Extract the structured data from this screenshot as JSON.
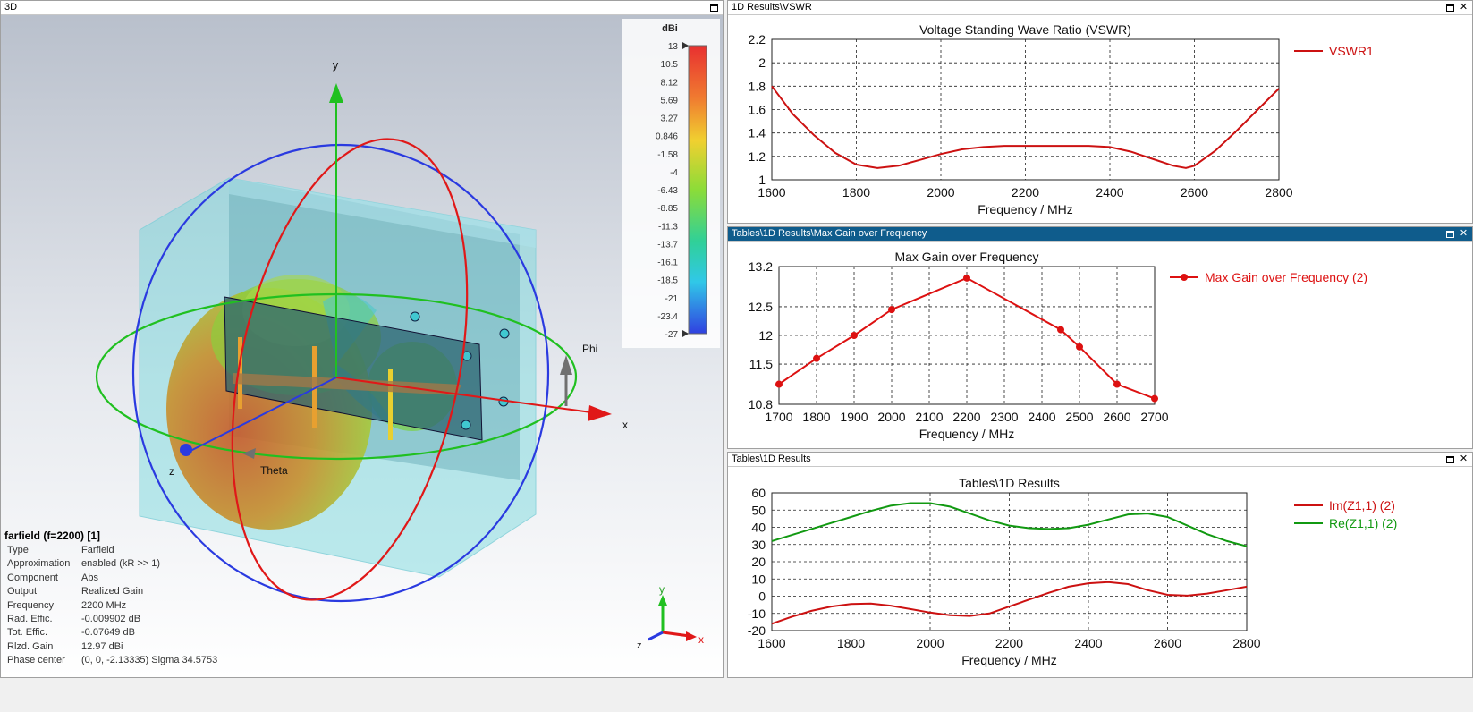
{
  "pane3d": {
    "title": "3D",
    "colorbar_unit": "dBi",
    "colorbar_ticks": [
      "13",
      "10.5",
      "8.12",
      "5.69",
      "3.27",
      "0.846",
      "-1.58",
      "-4",
      "-6.43",
      "-8.85",
      "-11.3",
      "-13.7",
      "-16.1",
      "-18.5",
      "-21",
      "-23.4",
      "-27"
    ],
    "axis_labels": {
      "x": "x",
      "y": "y",
      "z": "z",
      "phi": "Phi",
      "theta": "Theta"
    },
    "info": {
      "title": "farfield (f=2200) [1]",
      "rows": [
        {
          "k": "Type",
          "v": "Farfield"
        },
        {
          "k": "Approximation",
          "v": "enabled (kR >> 1)"
        },
        {
          "k": "Component",
          "v": "Abs"
        },
        {
          "k": "Output",
          "v": "Realized Gain"
        },
        {
          "k": "Frequency",
          "v": "2200 MHz"
        },
        {
          "k": "Rad. Effic.",
          "v": "-0.009902 dB"
        },
        {
          "k": "Tot. Effic.",
          "v": "-0.07649 dB"
        },
        {
          "k": "Rlzd. Gain",
          "v": "12.97 dBi"
        },
        {
          "k": "Phase center",
          "v": "(0, 0, -2.13335) Sigma 34.5753"
        }
      ]
    }
  },
  "pane_vswr": {
    "title": "1D Results\\VSWR"
  },
  "pane_gain": {
    "title": "Tables\\1D Results\\Max Gain over Frequency"
  },
  "pane_z": {
    "title": "Tables\\1D Results"
  },
  "chart_data": [
    {
      "type": "line",
      "title": "Voltage Standing Wave Ratio (VSWR)",
      "xlabel": "Frequency / MHz",
      "ylabel": "",
      "xlim": [
        1600,
        2800
      ],
      "ylim": [
        1,
        2.2
      ],
      "xticks": [
        1600,
        1800,
        2000,
        2200,
        2400,
        2600,
        2800
      ],
      "yticks": [
        1,
        1.2,
        1.4,
        1.6,
        1.8,
        2,
        2.2
      ],
      "grid": true,
      "legend": "right",
      "series": [
        {
          "name": "VSWR1",
          "color": "#cc1111",
          "x": [
            1600,
            1650,
            1700,
            1750,
            1800,
            1850,
            1900,
            1950,
            2000,
            2050,
            2100,
            2150,
            2200,
            2250,
            2300,
            2350,
            2400,
            2450,
            2500,
            2550,
            2580,
            2600,
            2650,
            2700,
            2750,
            2800
          ],
          "y": [
            1.8,
            1.56,
            1.38,
            1.23,
            1.13,
            1.1,
            1.12,
            1.17,
            1.22,
            1.26,
            1.28,
            1.29,
            1.29,
            1.29,
            1.29,
            1.29,
            1.28,
            1.24,
            1.18,
            1.12,
            1.1,
            1.12,
            1.25,
            1.42,
            1.6,
            1.78
          ]
        }
      ]
    },
    {
      "type": "line",
      "title": "Max Gain over Frequency",
      "xlabel": "Frequency / MHz",
      "ylabel": "",
      "xlim": [
        1700,
        2700
      ],
      "ylim": [
        10.8,
        13.2
      ],
      "xticks": [
        1700,
        1800,
        1900,
        2000,
        2100,
        2200,
        2300,
        2400,
        2500,
        2600,
        2700
      ],
      "yticks": [
        10.8,
        11.5,
        12,
        12.5,
        13.2
      ],
      "grid": true,
      "legend": "right",
      "series": [
        {
          "name": "Max Gain over Frequency (2)",
          "color": "#dd1111",
          "markers": true,
          "x": [
            1700,
            1800,
            1900,
            2000,
            2200,
            2450,
            2500,
            2600,
            2700
          ],
          "y": [
            11.15,
            11.6,
            12.0,
            12.45,
            13.0,
            12.1,
            11.8,
            11.15,
            10.9
          ]
        }
      ]
    },
    {
      "type": "line",
      "title": "Tables\\1D Results",
      "xlabel": "Frequency / MHz",
      "ylabel": "",
      "xlim": [
        1600,
        2800
      ],
      "ylim": [
        -20,
        60
      ],
      "xticks": [
        1600,
        1800,
        2000,
        2200,
        2400,
        2600,
        2800
      ],
      "yticks": [
        -20,
        -10,
        0,
        10,
        20,
        30,
        40,
        50,
        60
      ],
      "grid": true,
      "legend": "right",
      "series": [
        {
          "name": "Im(Z1,1) (2)",
          "color": "#cc1111",
          "x": [
            1600,
            1650,
            1700,
            1750,
            1800,
            1850,
            1900,
            1950,
            2000,
            2050,
            2100,
            2150,
            2200,
            2250,
            2300,
            2350,
            2400,
            2450,
            2500,
            2550,
            2600,
            2650,
            2700,
            2750,
            2800
          ],
          "y": [
            -16,
            -12,
            -8.5,
            -6,
            -4.5,
            -4.3,
            -5.5,
            -7.5,
            -9.5,
            -11,
            -11.5,
            -10,
            -6,
            -2,
            2,
            5.5,
            7.5,
            8.2,
            7,
            3.5,
            0.8,
            0.3,
            1.5,
            3.5,
            5.5
          ]
        },
        {
          "name": "Re(Z1,1) (2)",
          "color": "#119911",
          "x": [
            1600,
            1650,
            1700,
            1750,
            1800,
            1850,
            1900,
            1950,
            2000,
            2050,
            2100,
            2150,
            2200,
            2250,
            2300,
            2350,
            2400,
            2450,
            2500,
            2550,
            2600,
            2650,
            2700,
            2750,
            2800
          ],
          "y": [
            32,
            35.5,
            39,
            42.5,
            46,
            49.5,
            52.5,
            54,
            54,
            52,
            48,
            44,
            41,
            39.5,
            39,
            39.5,
            41.5,
            44.5,
            47.5,
            48,
            46,
            41,
            36,
            32,
            29
          ]
        }
      ]
    }
  ]
}
